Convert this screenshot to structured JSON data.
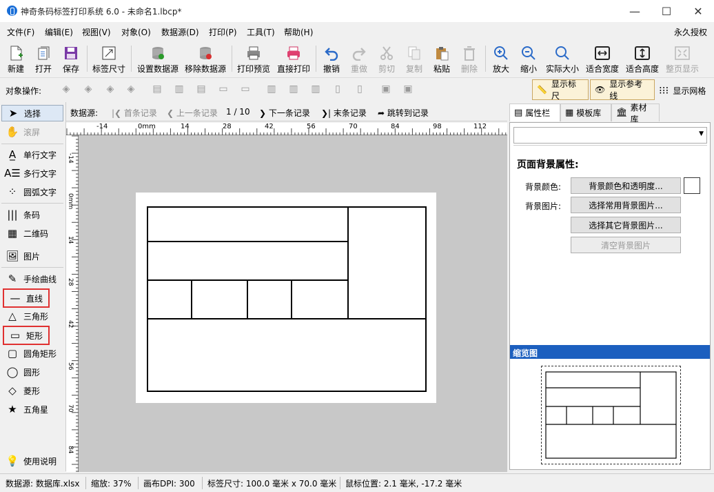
{
  "window": {
    "title": "神奇条码标签打印系统 6.0 - 未命名1.lbcp*",
    "controls": {
      "minimize": "—",
      "maximize": "☐",
      "close": "✕"
    }
  },
  "menu": {
    "items": [
      "文件(F)",
      "编辑(E)",
      "视图(V)",
      "对象(O)",
      "数据源(D)",
      "打印(P)",
      "工具(T)",
      "帮助(H)"
    ],
    "license": "永久授权"
  },
  "toolbar": {
    "items": [
      {
        "label": "新建",
        "icon": "new-file-icon",
        "enabled": true
      },
      {
        "label": "打开",
        "icon": "open-icon",
        "enabled": true
      },
      {
        "label": "保存",
        "icon": "save-icon",
        "enabled": true
      },
      {
        "label": "标签尺寸",
        "icon": "label-size-icon",
        "enabled": true
      },
      {
        "label": "设置数据源",
        "icon": "database-icon",
        "enabled": true
      },
      {
        "label": "移除数据源",
        "icon": "database-remove-icon",
        "enabled": true
      },
      {
        "label": "打印预览",
        "icon": "print-preview-icon",
        "enabled": true
      },
      {
        "label": "直接打印",
        "icon": "printer-icon",
        "enabled": true
      },
      {
        "label": "撤销",
        "icon": "undo-icon",
        "enabled": true
      },
      {
        "label": "重做",
        "icon": "redo-icon",
        "enabled": false
      },
      {
        "label": "剪切",
        "icon": "cut-icon",
        "enabled": false
      },
      {
        "label": "复制",
        "icon": "copy-icon",
        "enabled": false
      },
      {
        "label": "粘贴",
        "icon": "paste-icon",
        "enabled": true
      },
      {
        "label": "删除",
        "icon": "delete-icon",
        "enabled": false
      },
      {
        "label": "放大",
        "icon": "zoom-in-icon",
        "enabled": true
      },
      {
        "label": "缩小",
        "icon": "zoom-out-icon",
        "enabled": true
      },
      {
        "label": "实际大小",
        "icon": "zoom-actual-icon",
        "enabled": true
      },
      {
        "label": "适合宽度",
        "icon": "fit-width-icon",
        "enabled": true
      },
      {
        "label": "适合高度",
        "icon": "fit-height-icon",
        "enabled": true
      },
      {
        "label": "整页显示",
        "icon": "fit-page-icon",
        "enabled": false
      }
    ]
  },
  "objbar": {
    "label": "对象操作:",
    "show_ruler": "显示标尺",
    "show_guides": "显示参考线",
    "show_grid": "显示网格"
  },
  "tools": [
    "选择",
    "滚屏",
    "单行文字",
    "多行文字",
    "圆弧文字",
    "条码",
    "二维码",
    "图片",
    "手绘曲线",
    "直线",
    "三角形",
    "矩形",
    "圆角矩形",
    "圆形",
    "菱形",
    "五角星",
    "使用说明"
  ],
  "nav": {
    "label": "数据源:",
    "first": "首条记录",
    "prev": "上一条记录",
    "page": "1 / 10",
    "next": "下一条记录",
    "last": "末条记录",
    "jump": "跳转到记录"
  },
  "ruler": {
    "top": [
      "-14",
      "0mm",
      "14",
      "28",
      "42",
      "56",
      "70",
      "84",
      "98",
      "112"
    ],
    "left": [
      "-14",
      "0mm",
      "14",
      "28",
      "42",
      "56",
      "70",
      "84"
    ]
  },
  "right": {
    "tabs": [
      "属性栏",
      "模板库",
      "素材库"
    ],
    "section_title": "页面背景属性:",
    "bg_color_label": "背景颜色:",
    "bg_color_btn": "背景颜色和透明度...",
    "bg_image_label": "背景图片:",
    "bg_common_btn": "选择常用背景图片...",
    "bg_other_btn": "选择其它背景图片...",
    "bg_clear_btn": "清空背景图片",
    "preview_title": "缩览图"
  },
  "status": {
    "datasource": "数据源: 数据库.xlsx",
    "zoom": "缩放: 37%",
    "dpi": "画布DPI: 300",
    "size": "标签尺寸: 100.0 毫米 x 70.0 毫米",
    "mouse": "鼠标位置: 2.1 毫米, -17.2 毫米"
  },
  "colors": {
    "accent": "#1a6fd8",
    "highlight": "#e03030",
    "preview_header": "#1c5fbf"
  }
}
